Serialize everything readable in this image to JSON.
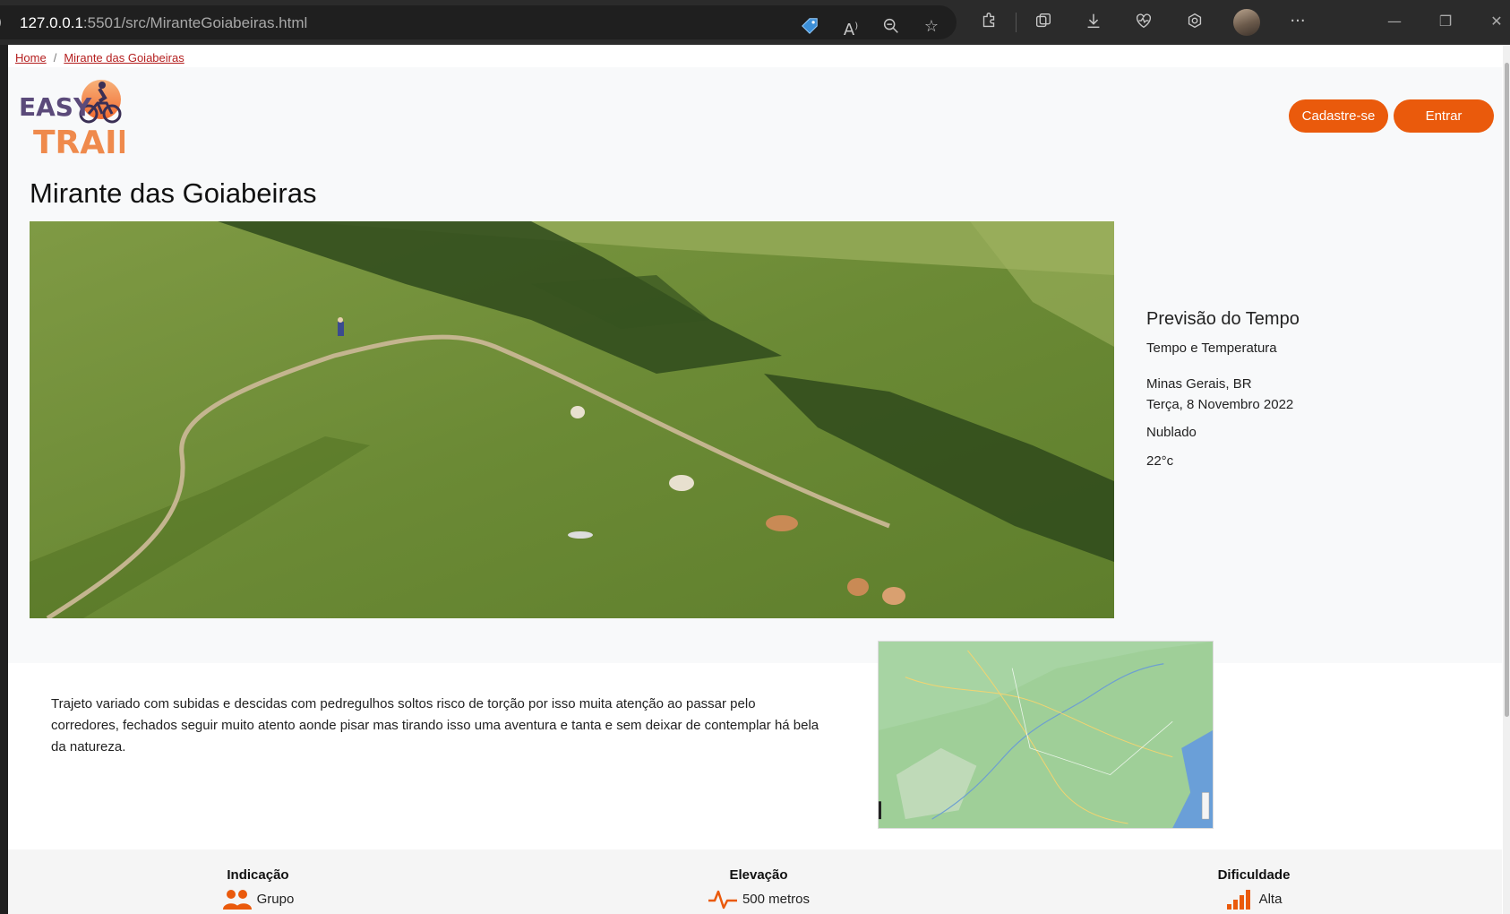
{
  "browser": {
    "url_host": "127.0.0.1",
    "url_path": ":5501/src/MiranteGoiabeiras.html",
    "icons": [
      "tag-icon",
      "read-aloud-icon",
      "zoom-out-icon",
      "add-favorite-icon",
      "extensions-icon",
      "collections-icon",
      "downloads-icon",
      "health-icon",
      "copilot-icon",
      "profile-avatar",
      "more-icon",
      "minimize-icon",
      "restore-icon",
      "close-icon"
    ]
  },
  "breadcrumb": {
    "home": "Home",
    "current": "Mirante das Goiabeiras"
  },
  "header": {
    "signup": "Cadastre-se",
    "login": "Entrar"
  },
  "page": {
    "title": "Mirante das Goiabeiras"
  },
  "weather": {
    "heading": "Previsão do Tempo",
    "subtitle": "Tempo e Temperatura",
    "location": "Minas Gerais, BR",
    "date": "Terça, 8 Novembro 2022",
    "condition": "Nublado",
    "temperature": "22°c"
  },
  "description": "Trajeto variado com subidas e descidas com pedregulhos soltos risco de torção por isso muita atenção ao passar pelo corredores, fechados seguir muito atento aonde pisar mas tirando isso uma aventura e tanta e sem deixar de contemplar há bela da natureza.",
  "stats": {
    "indicacao": {
      "label": "Indicação",
      "value": "Grupo"
    },
    "elevacao": {
      "label": "Elevação",
      "value": "500 metros"
    },
    "dificuldade": {
      "label": "Dificuldade",
      "value": "Alta"
    }
  },
  "colors": {
    "accent": "#ea5a0c",
    "link": "#b41e1e",
    "logo_purple": "#5b4a7a",
    "logo_orange": "#ef8a4c"
  }
}
